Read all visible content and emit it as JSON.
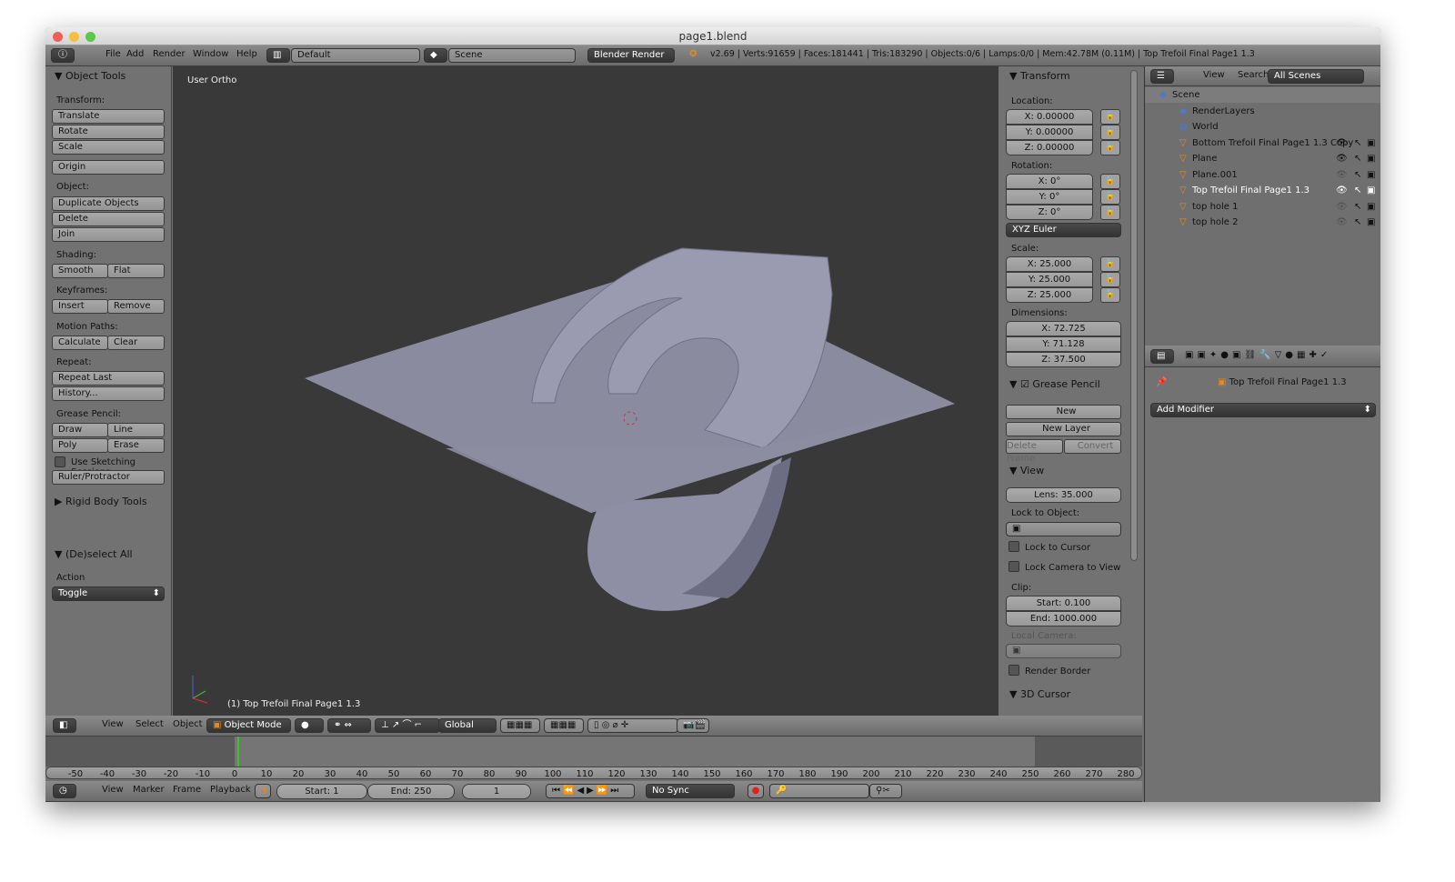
{
  "window": {
    "title": "page1.blend"
  },
  "topbar": {
    "menus": [
      "File",
      "Add",
      "Render",
      "Window",
      "Help"
    ],
    "layout": "Default",
    "scene": "Scene",
    "engine": "Blender Render",
    "stats": "v2.69 | Verts:91659 | Faces:181441 | Tris:183290 | Objects:0/6 | Lamps:0/0 | Mem:42.78M (0.11M) | Top Trefoil Final Page1 1.3"
  },
  "toolshelf": {
    "title": "Object Tools",
    "transform_label": "Transform:",
    "translate": "Translate",
    "rotate": "Rotate",
    "scale": "Scale",
    "origin": "Origin",
    "object_label": "Object:",
    "duplicate": "Duplicate Objects",
    "delete": "Delete",
    "join": "Join",
    "shading_label": "Shading:",
    "smooth": "Smooth",
    "flat": "Flat",
    "keyframes_label": "Keyframes:",
    "insert": "Insert",
    "remove": "Remove",
    "motion_label": "Motion Paths:",
    "calculate": "Calculate",
    "clear": "Clear",
    "repeat_label": "Repeat:",
    "repeat_last": "Repeat Last",
    "history": "History...",
    "gp_label": "Grease Pencil:",
    "draw": "Draw",
    "line": "Line",
    "poly": "Poly",
    "erase": "Erase",
    "sketch": "Use Sketching Sessions",
    "ruler": "Ruler/Protractor",
    "rigid": "Rigid Body Tools",
    "deselect_title": "(De)select All",
    "action_label": "Action",
    "action_value": "Toggle"
  },
  "viewport": {
    "view_label": "User Ortho",
    "object_label": "(1) Top Trefoil Final Page1 1.3",
    "mesh_color": "#8e8ea0",
    "bg": "#393939"
  },
  "npanel": {
    "transform": "Transform",
    "location": "Location:",
    "loc": [
      "X: 0.00000",
      "Y: 0.00000",
      "Z: 0.00000"
    ],
    "rotation": "Rotation:",
    "rot": [
      "X: 0°",
      "Y: 0°",
      "Z: 0°"
    ],
    "rot_mode": "XYZ Euler",
    "scale": "Scale:",
    "scl": [
      "X: 25.000",
      "Y: 25.000",
      "Z: 25.000"
    ],
    "dimensions": "Dimensions:",
    "dim": [
      "X: 72.725",
      "Y: 71.128",
      "Z: 37.500"
    ],
    "grease": "Grease Pencil",
    "new": "New",
    "new_layer": "New Layer",
    "delete_frame": "Delete Frame",
    "convert": "Convert",
    "view": "View",
    "lens": "Lens: 35.000",
    "lock_obj": "Lock to Object:",
    "lock_cursor": "Lock to Cursor",
    "lock_camera": "Lock Camera to View",
    "clip": "Clip:",
    "clip_start": "Start: 0.100",
    "clip_end": "End: 1000.000",
    "local_camera": "Local Camera:",
    "render_border": "Render Border",
    "cursor3d": "3D Cursor"
  },
  "outliner": {
    "view": "View",
    "search": "Search",
    "filter": "All Scenes",
    "items": [
      {
        "label": "Scene",
        "icon": "scene-icon",
        "depth": 0
      },
      {
        "label": "RenderLayers",
        "icon": "renderlayers-icon",
        "depth": 1
      },
      {
        "label": "World",
        "icon": "world-icon",
        "depth": 1
      },
      {
        "label": "Bottom Trefoil Final Page1 1.3 Copy",
        "icon": "mesh-object-icon",
        "depth": 1,
        "visible": true
      },
      {
        "label": "Plane",
        "icon": "mesh-object-icon",
        "depth": 1,
        "visible": true
      },
      {
        "label": "Plane.001",
        "icon": "mesh-object-icon",
        "depth": 1,
        "visible": false
      },
      {
        "label": "Top Trefoil Final Page1 1.3",
        "icon": "mesh-object-icon",
        "depth": 1,
        "visible": true,
        "selected": true
      },
      {
        "label": "top hole 1",
        "icon": "mesh-object-icon",
        "depth": 1,
        "visible": false
      },
      {
        "label": "top hole 2",
        "icon": "mesh-object-icon",
        "depth": 1,
        "visible": false
      }
    ]
  },
  "properties": {
    "breadcrumb": "Top Trefoil Final Page1 1.3",
    "add_modifier": "Add Modifier"
  },
  "view3d_header": {
    "menus": [
      "View",
      "Select",
      "Object"
    ],
    "mode": "Object Mode",
    "orientation": "Global"
  },
  "timeline": {
    "ticks": [
      "-50",
      "-40",
      "-30",
      "-20",
      "-10",
      "0",
      "10",
      "20",
      "30",
      "40",
      "50",
      "60",
      "70",
      "80",
      "90",
      "100",
      "110",
      "120",
      "130",
      "140",
      "150",
      "160",
      "170",
      "180",
      "190",
      "200",
      "210",
      "220",
      "230",
      "240",
      "250",
      "260",
      "270",
      "280"
    ],
    "current_frame": 1,
    "menus": [
      "View",
      "Marker",
      "Frame",
      "Playback"
    ],
    "start": "Start: 1",
    "end": "End: 250",
    "frame": "1",
    "sync": "No Sync",
    "playhead_color": "#3fbf2a"
  }
}
